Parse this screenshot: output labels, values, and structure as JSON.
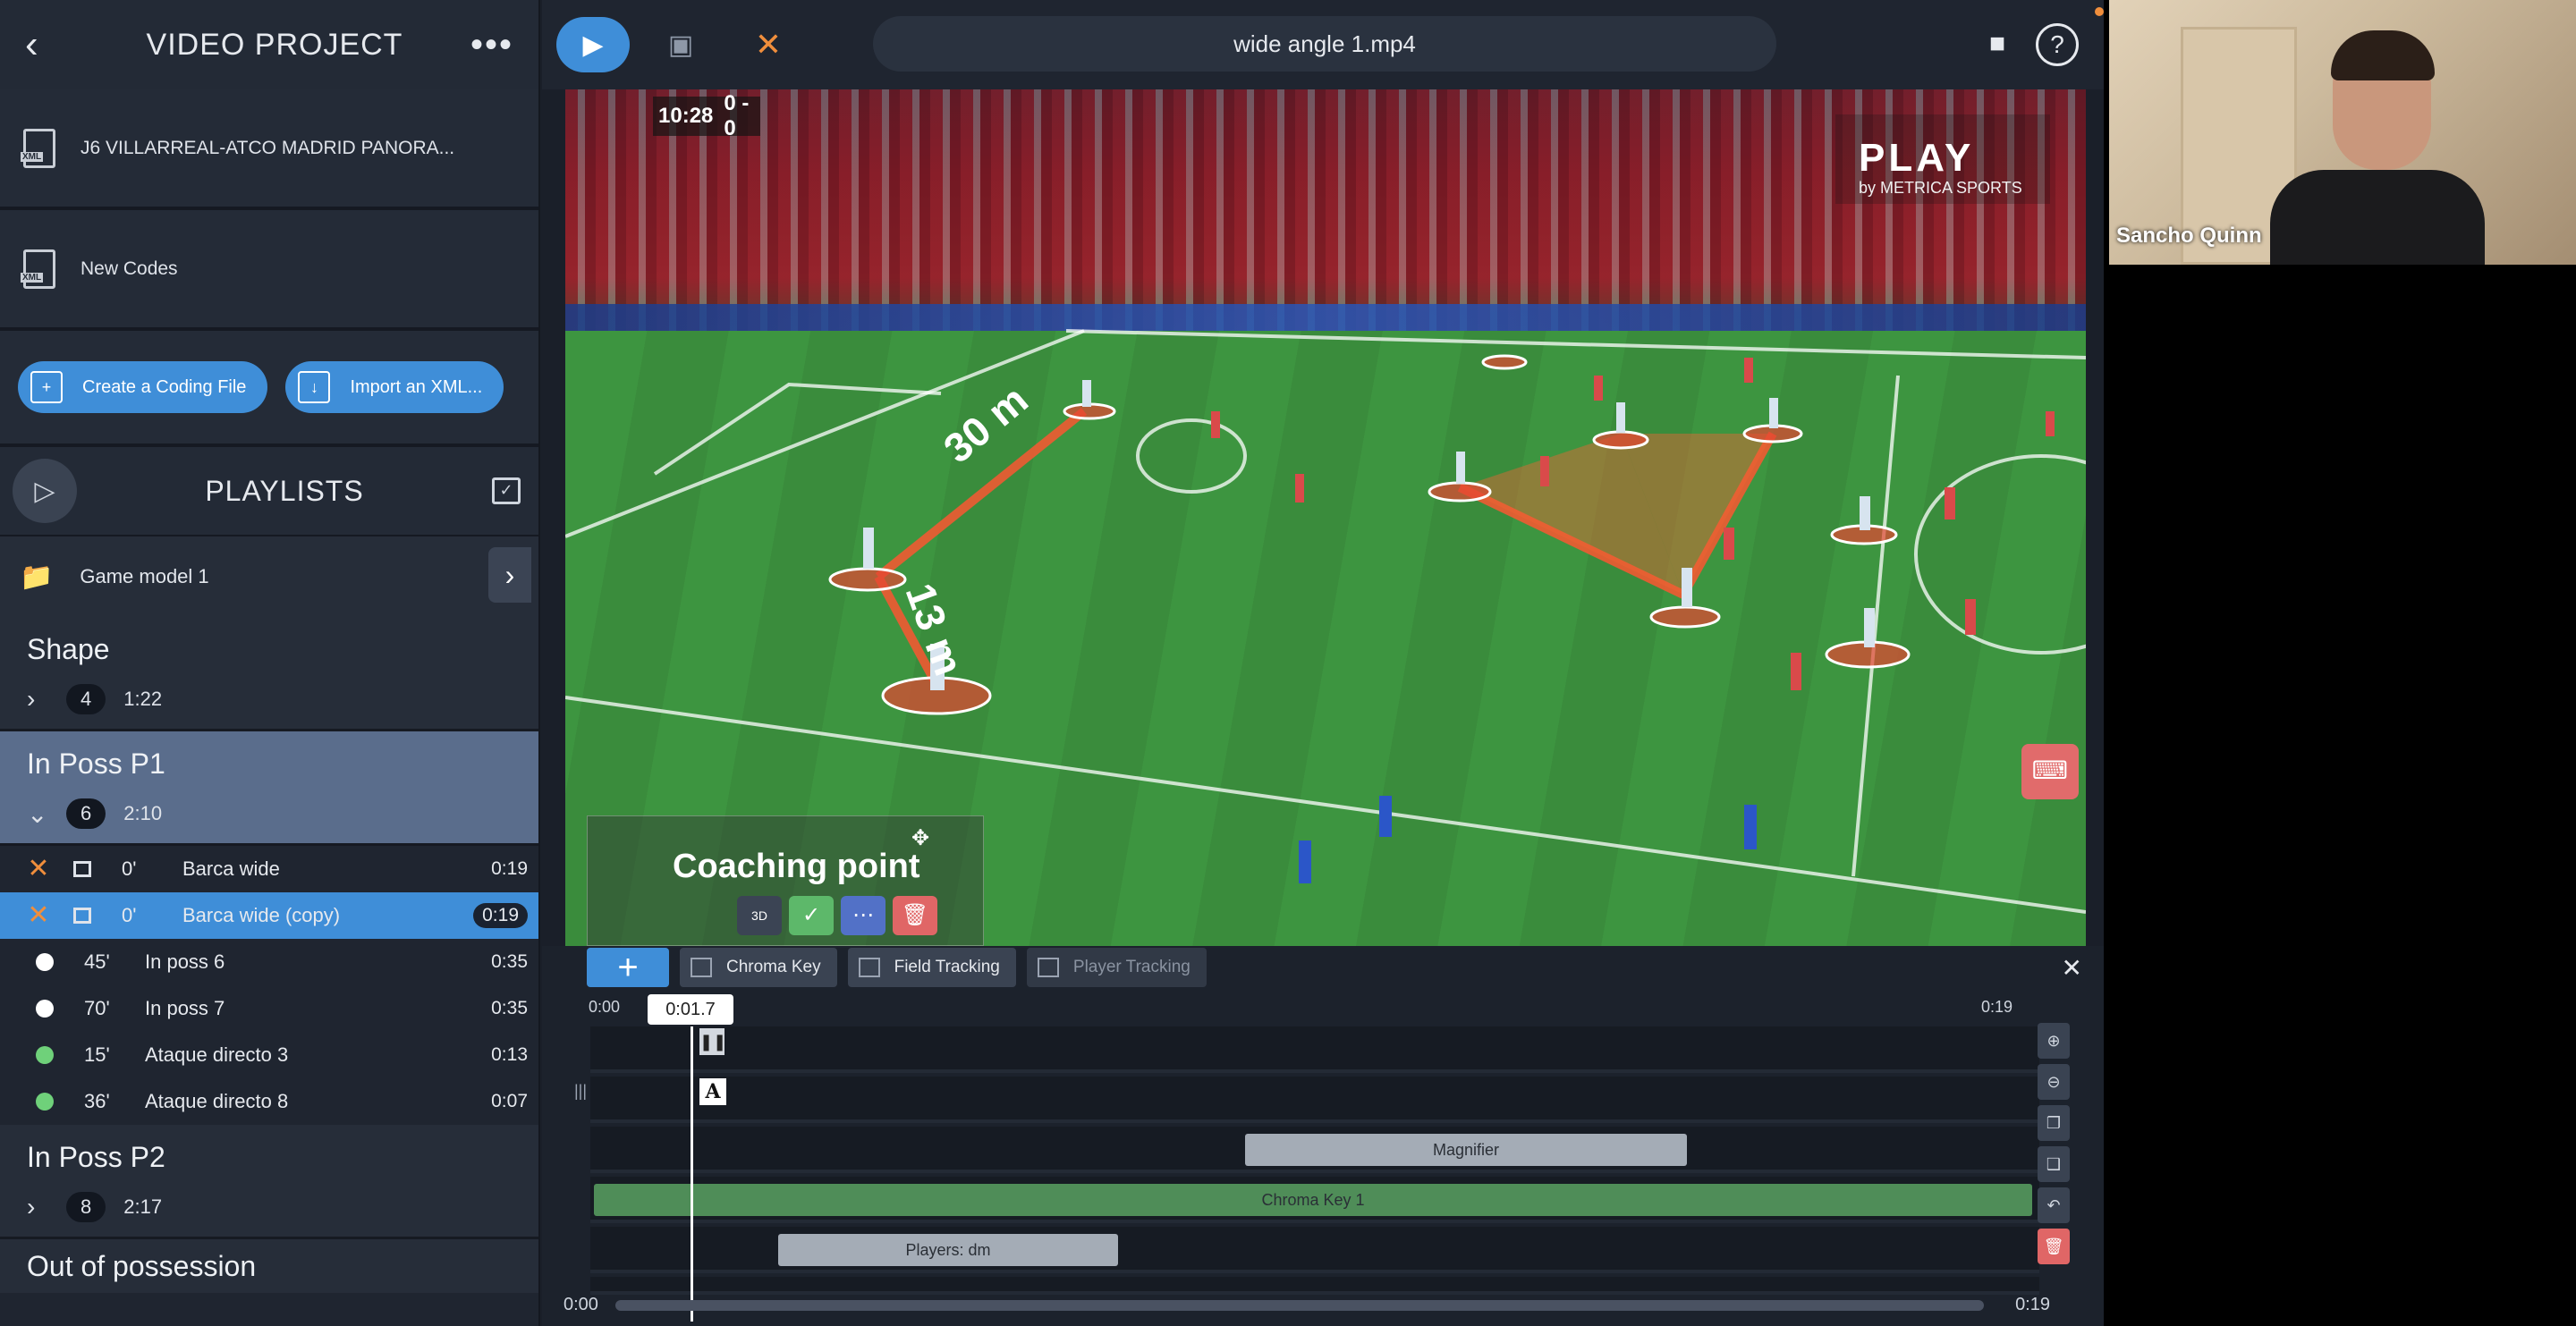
{
  "sidebar": {
    "title": "VIDEO PROJECT",
    "files": [
      {
        "label": "J6 VILLARREAL-ATCO MADRID PANORA..."
      },
      {
        "label": "New Codes"
      }
    ],
    "actions": {
      "create": "Create a Coding File",
      "import": "Import an XML..."
    },
    "playlists_title": "PLAYLISTS",
    "folder": "Game model 1",
    "groups": [
      {
        "title": "Shape",
        "count": "4",
        "duration": "1:22"
      },
      {
        "title": "In Poss P1",
        "count": "6",
        "duration": "2:10"
      },
      {
        "title": "In Poss P2",
        "count": "8",
        "duration": "2:17"
      },
      {
        "title": "Out of possession"
      }
    ],
    "clips": [
      {
        "time": "0'",
        "name": "Barca wide",
        "duration": "0:19"
      },
      {
        "time": "0'",
        "name": "Barca wide (copy)",
        "duration": "0:19"
      },
      {
        "time": "45'",
        "name": "In poss 6",
        "duration": "0:35",
        "color": "#ffffff"
      },
      {
        "time": "70'",
        "name": "In poss 7",
        "duration": "0:35",
        "color": "#ffffff"
      },
      {
        "time": "15'",
        "name": "Ataque directo 3",
        "duration": "0:13",
        "color": "#6fd17a"
      },
      {
        "time": "36'",
        "name": "Ataque directo 8",
        "duration": "0:07",
        "color": "#6fd17a"
      }
    ]
  },
  "topbar": {
    "filename": "wide angle 1.mp4"
  },
  "video": {
    "clock": "10:28",
    "score": "0 - 0",
    "brand": "PLAY",
    "brand_sub": "by METRICA SPORTS",
    "distance_1": "30 m",
    "distance_2": "13 m",
    "coaching_text": "Coaching point",
    "tool_3d": "3D"
  },
  "timeline": {
    "tools": {
      "chroma": "Chroma Key",
      "field": "Field Tracking",
      "player": "Player Tracking"
    },
    "start": "0:00",
    "end": "0:19",
    "playhead": "0:01.7",
    "tracks": [
      {
        "label": "Magnifier"
      },
      {
        "label": "Chroma Key 1"
      },
      {
        "label": "Players: dm"
      }
    ],
    "scrub_start": "0:00",
    "scrub_end": "0:19"
  },
  "camera": {
    "name": "Sancho Quinn"
  },
  "colors": {
    "accent": "#3f8ed8",
    "orange": "#f08e3c",
    "red": "#e06666",
    "green": "#5db86a"
  }
}
